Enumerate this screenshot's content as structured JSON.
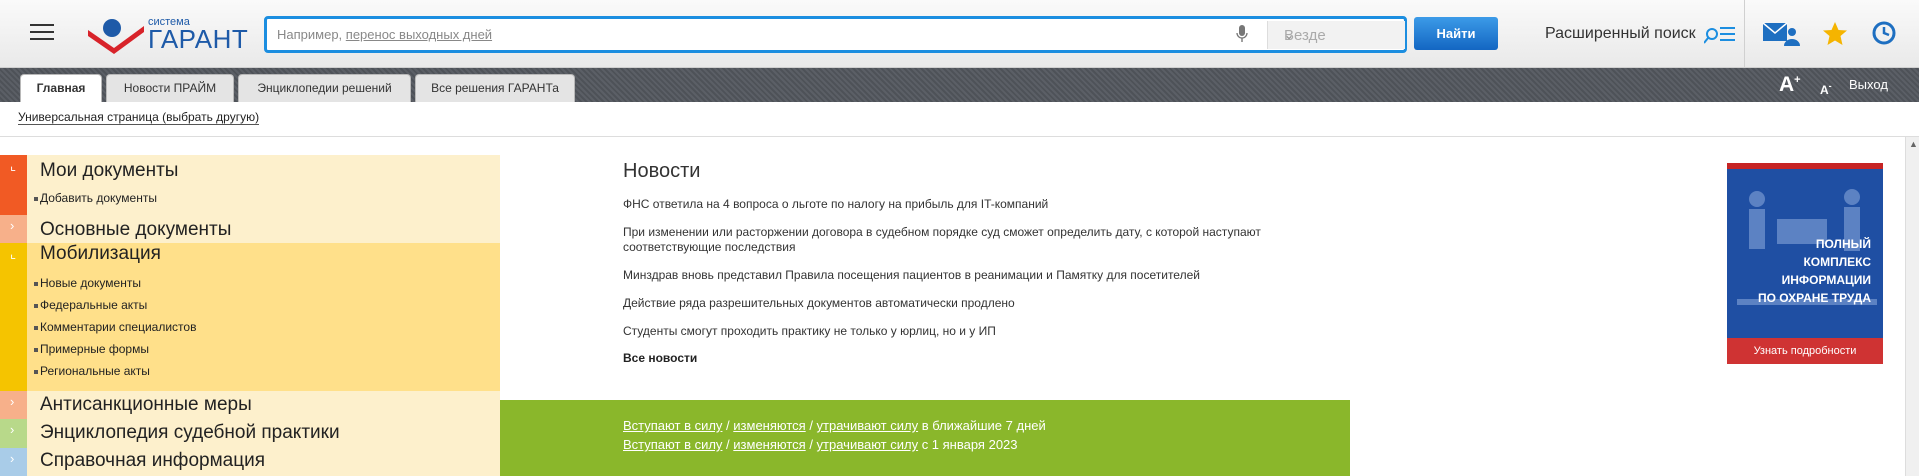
{
  "header": {
    "logo_small": "система",
    "logo_big": "ГАРАНТ",
    "search_placeholder_prefix": "Например, ",
    "search_placeholder_example": "перенос выходных дней",
    "scope_value": "Везде",
    "find_label": "Найти",
    "advanced_label": "Расширенный поиск"
  },
  "tabs": [
    {
      "label": "Главная"
    },
    {
      "label": "Новости ПРАЙМ"
    },
    {
      "label": "Энциклопедии решений"
    },
    {
      "label": "Все решения ГАРАНТа"
    }
  ],
  "tabbar_right": {
    "font_increase": "A",
    "font_decrease": "A",
    "logout": "Выход"
  },
  "subheader": {
    "link": "Универсальная страница (выбрать другую)"
  },
  "sidebar": {
    "sections": [
      {
        "title": "Мои документы",
        "items": [
          "Добавить документы"
        ]
      },
      {
        "title": "Основные документы",
        "items": []
      },
      {
        "title": "Мобилизация",
        "items": [
          "Новые документы",
          "Федеральные акты",
          "Комментарии специалистов",
          "Примерные формы",
          "Региональные акты"
        ]
      },
      {
        "title": "Антисанкционные меры",
        "items": []
      },
      {
        "title": "Энциклопедия судебной практики",
        "items": []
      },
      {
        "title": "Справочная информация",
        "items": []
      }
    ]
  },
  "news": {
    "heading": "Новости",
    "items": [
      "ФНС ответила на 4 вопроса о льготе по налогу на прибыль для IT-компаний",
      "При изменении или расторжении договора в судебном порядке суд сможет определить дату, с которой наступают соответствующие последствия",
      "Минздрав вновь представил Правила посещения пациентов в реанимации и Памятку для посетителей",
      "Действие ряда разрешительных документов автоматически продлено",
      "Студенты смогут проходить практику не только у юрлиц, но и у ИП"
    ],
    "all_label": "Все новости"
  },
  "changes": {
    "enter": "Вступают в силу",
    "change": "изменяются",
    "lose": "утрачивают силу",
    "slash": " / ",
    "period1": " в ближайшие 7 дней",
    "period2": " с 1 января 2023"
  },
  "banner": {
    "line1": "Полный",
    "line2": "комплекс",
    "line3": "информации",
    "line4": "по охране труда",
    "more": "Узнать подробности"
  },
  "colors": {
    "accent_blue": "#1c8ee0",
    "sidebar_bg": "#fdf0cc",
    "mobilization_bg": "#ffe08a",
    "green_block": "#8ab72b",
    "marker_red": "#f15a24"
  }
}
